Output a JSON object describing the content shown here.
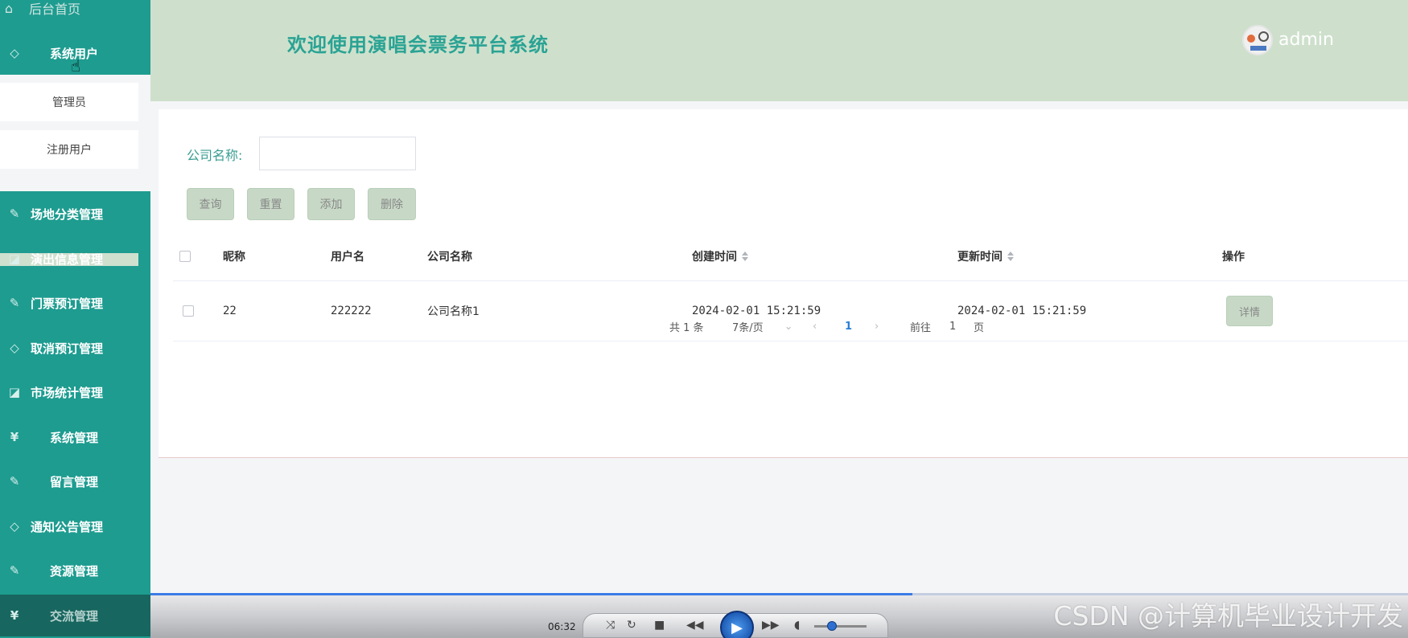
{
  "sidebar": {
    "home": "后台首页",
    "system_users": "系统用户",
    "sub_items": [
      "管理员",
      "注册用户"
    ],
    "items": [
      "场地分类管理",
      "演出信息管理",
      "门票预订管理",
      "取消预订管理",
      "市场统计管理",
      "系统管理",
      "留言管理",
      "通知公告管理",
      "资源管理",
      "交流管理"
    ],
    "accent": "#1e9c90"
  },
  "header": {
    "title": "欢迎使用演唱会票务平台系统",
    "username": "admin",
    "background": "#cee0cc"
  },
  "search": {
    "label": "公司名称:",
    "value": "",
    "placeholder": ""
  },
  "buttons": {
    "query": "查询",
    "reset": "重置",
    "add": "添加",
    "delete": "删除"
  },
  "table": {
    "columns": [
      "昵称",
      "用户名",
      "公司名称",
      "创建时间",
      "更新时间",
      "操作"
    ],
    "rows": [
      {
        "nickname": "22",
        "username": "222222",
        "company": "公司名称1",
        "created": "2024-02-01 15:21:59",
        "updated": "2024-02-01 15:21:59",
        "action": "详情"
      }
    ]
  },
  "pagination": {
    "total": "共 1 条",
    "page_size": "7条/页",
    "current": "1",
    "goto_label": "前往",
    "goto_value": "1",
    "page_unit": "页"
  },
  "video": {
    "time": "06:32",
    "progress": 0.606
  },
  "watermark": "CSDN @计算机毕业设计开发"
}
